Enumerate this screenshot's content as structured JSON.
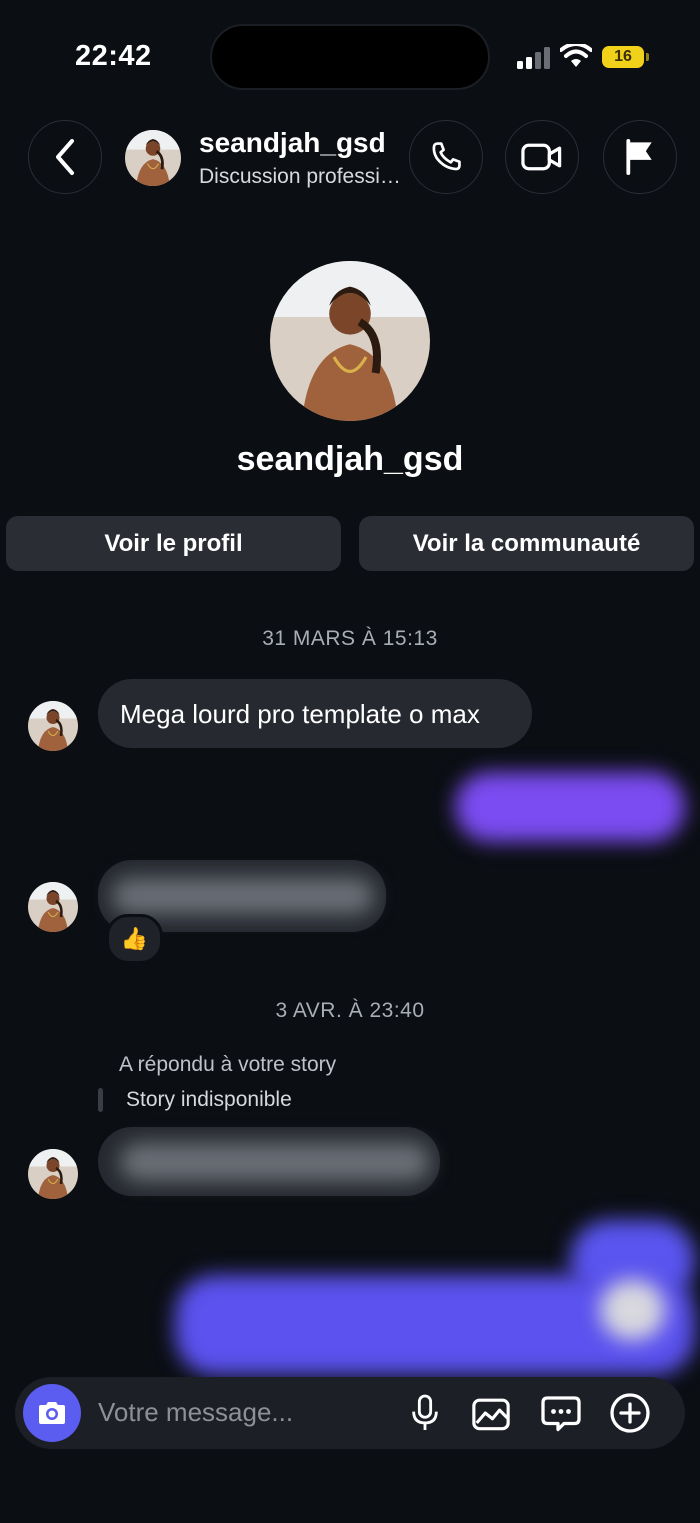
{
  "status_bar": {
    "time": "22:42",
    "battery": "16"
  },
  "header": {
    "name": "seandjah_gsd",
    "subtitle": "Discussion professionnelle",
    "icons": [
      "back-icon",
      "phone-icon",
      "video-icon",
      "flag-icon"
    ]
  },
  "profile": {
    "name": "seandjah_gsd",
    "view_profile": "Voir le profil",
    "view_community": "Voir la communauté"
  },
  "conversation": {
    "date1": "31 MARS À 15:13",
    "msg1": "Mega lourd pro template o max",
    "reaction": "👍",
    "date2": "3 AVR. À 23:40",
    "story_reply": "A répondu à votre story",
    "story_unavailable": "Story indisponible"
  },
  "composer": {
    "placeholder": "Votre message...",
    "icons": [
      "camera-icon",
      "mic-icon",
      "gallery-icon",
      "sticker-icon",
      "add-icon"
    ]
  },
  "colors": {
    "background": "#0b0e13",
    "accent": "#5b5cf0",
    "outgoing": "#7b4cf2",
    "bubble_in": "#262930"
  }
}
